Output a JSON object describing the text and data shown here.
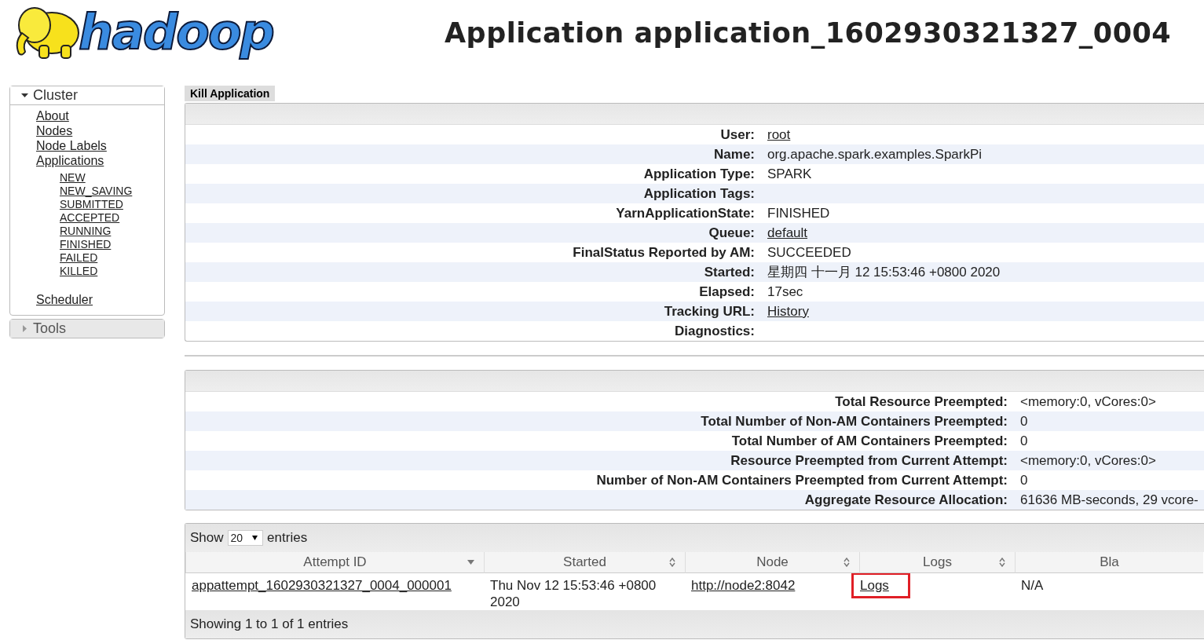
{
  "logo": {
    "text": "hadoop"
  },
  "title": "Application application_1602930321327_0004",
  "sidebar": [
    {
      "label": "Cluster",
      "expanded": true,
      "items": [
        {
          "label": "About"
        },
        {
          "label": "Nodes"
        },
        {
          "label": "Node Labels"
        },
        {
          "label": "Applications",
          "children": [
            {
              "label": "NEW"
            },
            {
              "label": "NEW_SAVING"
            },
            {
              "label": "SUBMITTED"
            },
            {
              "label": "ACCEPTED"
            },
            {
              "label": "RUNNING"
            },
            {
              "label": "FINISHED"
            },
            {
              "label": "FAILED"
            },
            {
              "label": "KILLED"
            }
          ]
        },
        {
          "label": "Scheduler"
        }
      ]
    },
    {
      "label": "Tools",
      "expanded": false
    }
  ],
  "actions": [
    "Kill Application"
  ],
  "overview": [
    {
      "label": "User:",
      "value": "root",
      "link": true
    },
    {
      "label": "Name:",
      "value": "org.apache.spark.examples.SparkPi",
      "link": false
    },
    {
      "label": "Application Type:",
      "value": "SPARK",
      "link": false
    },
    {
      "label": "Application Tags:"
    },
    {
      "label": "YarnApplicationState:",
      "value": "FINISHED",
      "link": false
    },
    {
      "label": "Queue:",
      "value": "default",
      "link": true
    },
    {
      "label": "FinalStatus Reported by AM:",
      "value": "SUCCEEDED",
      "link": false
    },
    {
      "label": "Started:",
      "value": "星期四 十一月 12 15:53:46 +0800 2020",
      "link": false
    },
    {
      "label": "Elapsed:",
      "value": "17sec",
      "link": false
    },
    {
      "label": "Tracking URL:",
      "value": "History",
      "link": true
    },
    {
      "label": "Diagnostics:"
    }
  ],
  "preemption": [
    {
      "label": "Total Resource Preempted:",
      "value": "<memory:0, vCores:0>"
    },
    {
      "label": "Total Number of Non-AM Containers Preempted:",
      "value": "0"
    },
    {
      "label": "Total Number of AM Containers Preempted:",
      "value": "0"
    },
    {
      "label": "Resource Preempted from Current Attempt:",
      "value": "<memory:0, vCores:0>"
    },
    {
      "label": "Number of Non-AM Containers Preempted from Current Attempt:",
      "value": "0"
    },
    {
      "label": "Aggregate Resource Allocation:",
      "value": "61636 MB-seconds, 29 vcore-"
    }
  ],
  "attempts": {
    "show_label": "Show",
    "page_size": "20",
    "entries_label": "entries",
    "columns": [
      {
        "label": "Attempt ID",
        "sorted": true
      },
      {
        "label": "Started",
        "sorted": false
      },
      {
        "label": "Node",
        "sorted": false
      },
      {
        "label": "Logs",
        "sorted": false
      },
      {
        "label": "Bla"
      }
    ],
    "rows": [
      {
        "cells": [
          {
            "text": "appattempt_1602930321327_0004_000001",
            "link": true,
            "highlighted": false
          },
          {
            "text": "Thu Nov 12 15:53:46 +0800 2020",
            "link": false,
            "highlighted": false
          },
          {
            "text": "http://node2:8042",
            "link": true,
            "highlighted": false
          },
          {
            "text": "Logs",
            "link": true,
            "highlighted": true
          },
          {
            "text": "N/A",
            "link": false,
            "highlighted": false
          }
        ]
      }
    ],
    "info": "Showing 1 to 1 of 1 entries"
  }
}
